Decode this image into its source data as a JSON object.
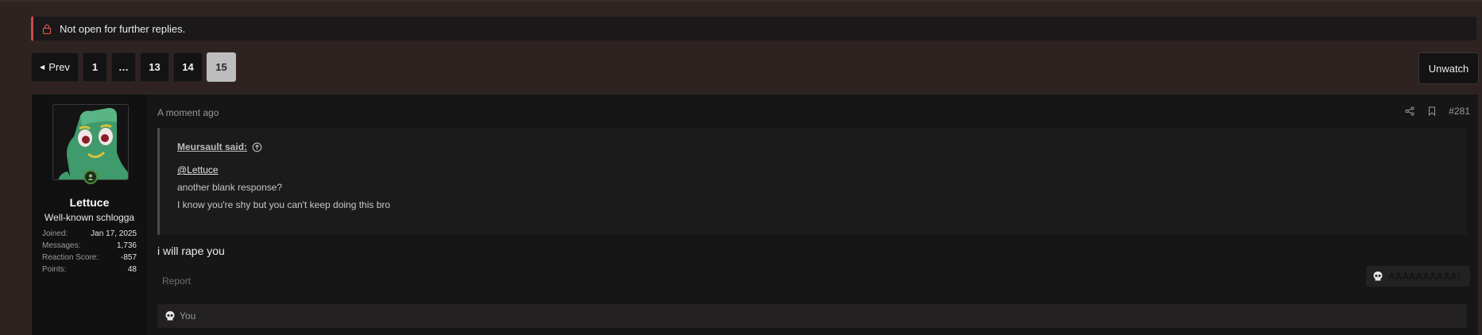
{
  "thread_notice": {
    "text": "Not open for further replies."
  },
  "pagination": {
    "prev_label": "Prev",
    "pages": [
      "1",
      "…",
      "13",
      "14",
      "15"
    ],
    "current_page": "15"
  },
  "watch_button": {
    "label": "Unwatch"
  },
  "post": {
    "timestamp": "A moment ago",
    "post_number": "#281",
    "author": {
      "name": "Lettuce",
      "title": "Well-known schlogga",
      "stats": [
        {
          "label": "Joined:",
          "value": "Jan 17, 2025"
        },
        {
          "label": "Messages:",
          "value": "1,736"
        },
        {
          "label": "Reaction Score:",
          "value": "-857"
        },
        {
          "label": "Points:",
          "value": "48"
        }
      ]
    },
    "quote": {
      "attribution": "Meursault said:",
      "mention": "@Lettuce",
      "lines": [
        "another blank response?",
        "I know you're shy but you can't keep doing this bro"
      ]
    },
    "body": "i will rape you",
    "report_label": "Report",
    "reaction_label": "AAAAAAAAAA!",
    "reactions_summary": "You"
  },
  "colors": {
    "page_bg": "#2f2322",
    "panel_bg": "#171616",
    "notice_accent": "#c84a4a",
    "current_page_bg": "#bdbdbd",
    "online_indicator": "#4c8c3c"
  },
  "icons": {
    "notice": "lock-icon",
    "prev": "caret-left-icon",
    "share": "share-icon",
    "bookmark": "bookmark-icon",
    "quote_jump": "arrow-up-circle-icon",
    "reaction": "skull-icon"
  }
}
